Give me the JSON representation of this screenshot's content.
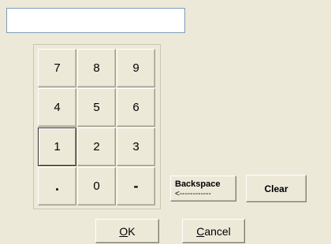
{
  "entry": {
    "value": ""
  },
  "keypad": {
    "keys": [
      "7",
      "8",
      "9",
      "4",
      "5",
      "6",
      "1",
      "2",
      "3",
      ".",
      "0",
      "-"
    ]
  },
  "buttons": {
    "backspace_label": "Backspace",
    "backspace_arrow": "<------------",
    "clear_label": "Clear",
    "ok_mnemonic": "O",
    "ok_rest": "K",
    "cancel_mnemonic": "C",
    "cancel_rest": "ancel"
  },
  "colors": {
    "background": "#ece9d8",
    "field_border": "#7f9db9"
  }
}
